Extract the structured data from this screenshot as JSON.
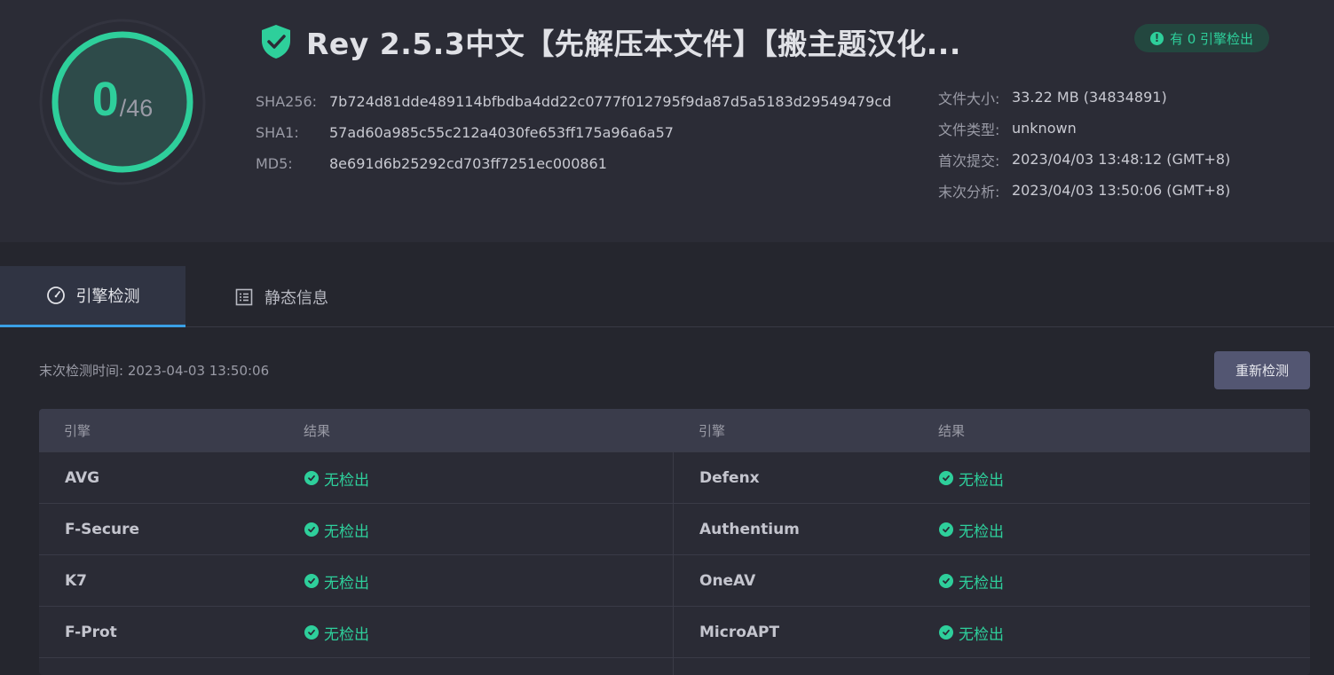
{
  "summary": {
    "detected": "0",
    "total": "/46",
    "detected_ratio": 0
  },
  "file": {
    "title": "Rey 2.5.3中文【先解压本文件】【搬主题汉化...",
    "hashes": [
      {
        "label": "SHA256:",
        "value": "7b724d81dde489114bfbdba4dd22c0777f012795f9da87d5a5183d29549479cd"
      },
      {
        "label": "SHA1:",
        "value": "57ad60a985c55c212a4030fe653ff175a96a6a57"
      },
      {
        "label": "MD5:",
        "value": "8e691d6b25292cd703ff7251ec000861"
      }
    ],
    "meta": [
      {
        "label": "文件大小:",
        "value": "33.22 MB (34834891)"
      },
      {
        "label": "文件类型:",
        "value": "unknown"
      },
      {
        "label": "首次提交:",
        "value": "2023/04/03 13:48:12 (GMT+8)"
      },
      {
        "label": "末次分析:",
        "value": "2023/04/03 13:50:06 (GMT+8)"
      }
    ]
  },
  "badge": {
    "text": "有 0 引擎检出",
    "icon": "alert-icon"
  },
  "tabs": [
    {
      "label": "引擎检测",
      "icon": "gauge-icon",
      "active": true
    },
    {
      "label": "静态信息",
      "icon": "document-list-icon",
      "active": false
    }
  ],
  "scan": {
    "last_scan": "末次检测时间: 2023-04-03 13:50:06",
    "rescan_label": "重新检测"
  },
  "table": {
    "headers": [
      "引擎",
      "结果",
      "引擎",
      "结果"
    ],
    "rows": [
      [
        {
          "engine": "AVG",
          "result": "无检出"
        },
        {
          "engine": "Defenx",
          "result": "无检出"
        }
      ],
      [
        {
          "engine": "F-Secure",
          "result": "无检出"
        },
        {
          "engine": "Authentium",
          "result": "无检出"
        }
      ],
      [
        {
          "engine": "K7",
          "result": "无检出"
        },
        {
          "engine": "OneAV",
          "result": "无检出"
        }
      ],
      [
        {
          "engine": "F-Prot",
          "result": "无检出"
        },
        {
          "engine": "MicroAPT",
          "result": "无检出"
        }
      ],
      [
        {
          "engine": "",
          "result": ""
        },
        {
          "engine": "",
          "result": ""
        }
      ]
    ]
  },
  "colors": {
    "accent_green": "#2ecf9b",
    "tab_underline": "#3aa0e6",
    "background": "#25262e"
  }
}
